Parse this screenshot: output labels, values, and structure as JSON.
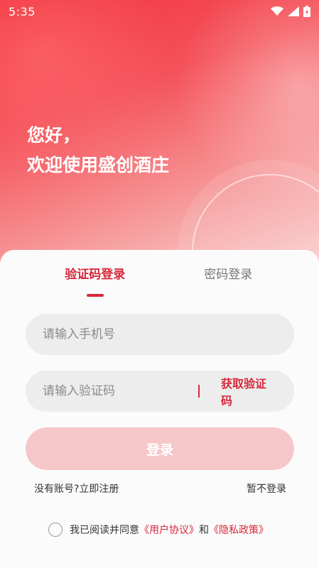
{
  "status": {
    "time": "5:35"
  },
  "greeting": {
    "line1": "您好，",
    "line2": "欢迎使用盛创酒庄"
  },
  "tabs": [
    {
      "label": "验证码登录",
      "active": true
    },
    {
      "label": "密码登录",
      "active": false
    }
  ],
  "phone": {
    "placeholder": "请输入手机号"
  },
  "code": {
    "placeholder": "请输入验证码",
    "get_code_label": "获取验证码"
  },
  "login_button": "登录",
  "links": {
    "register": "没有账号?立即注册",
    "skip": "暂不登录"
  },
  "agreement": {
    "prefix": "我已阅读并同意",
    "user_agreement": "《用户协议》",
    "and": "和",
    "privacy_policy": "《隐私政策》"
  },
  "colors": {
    "accent": "#d7283a",
    "hero_start": "#f3343f",
    "button_disabled": "#f6c7c9"
  }
}
